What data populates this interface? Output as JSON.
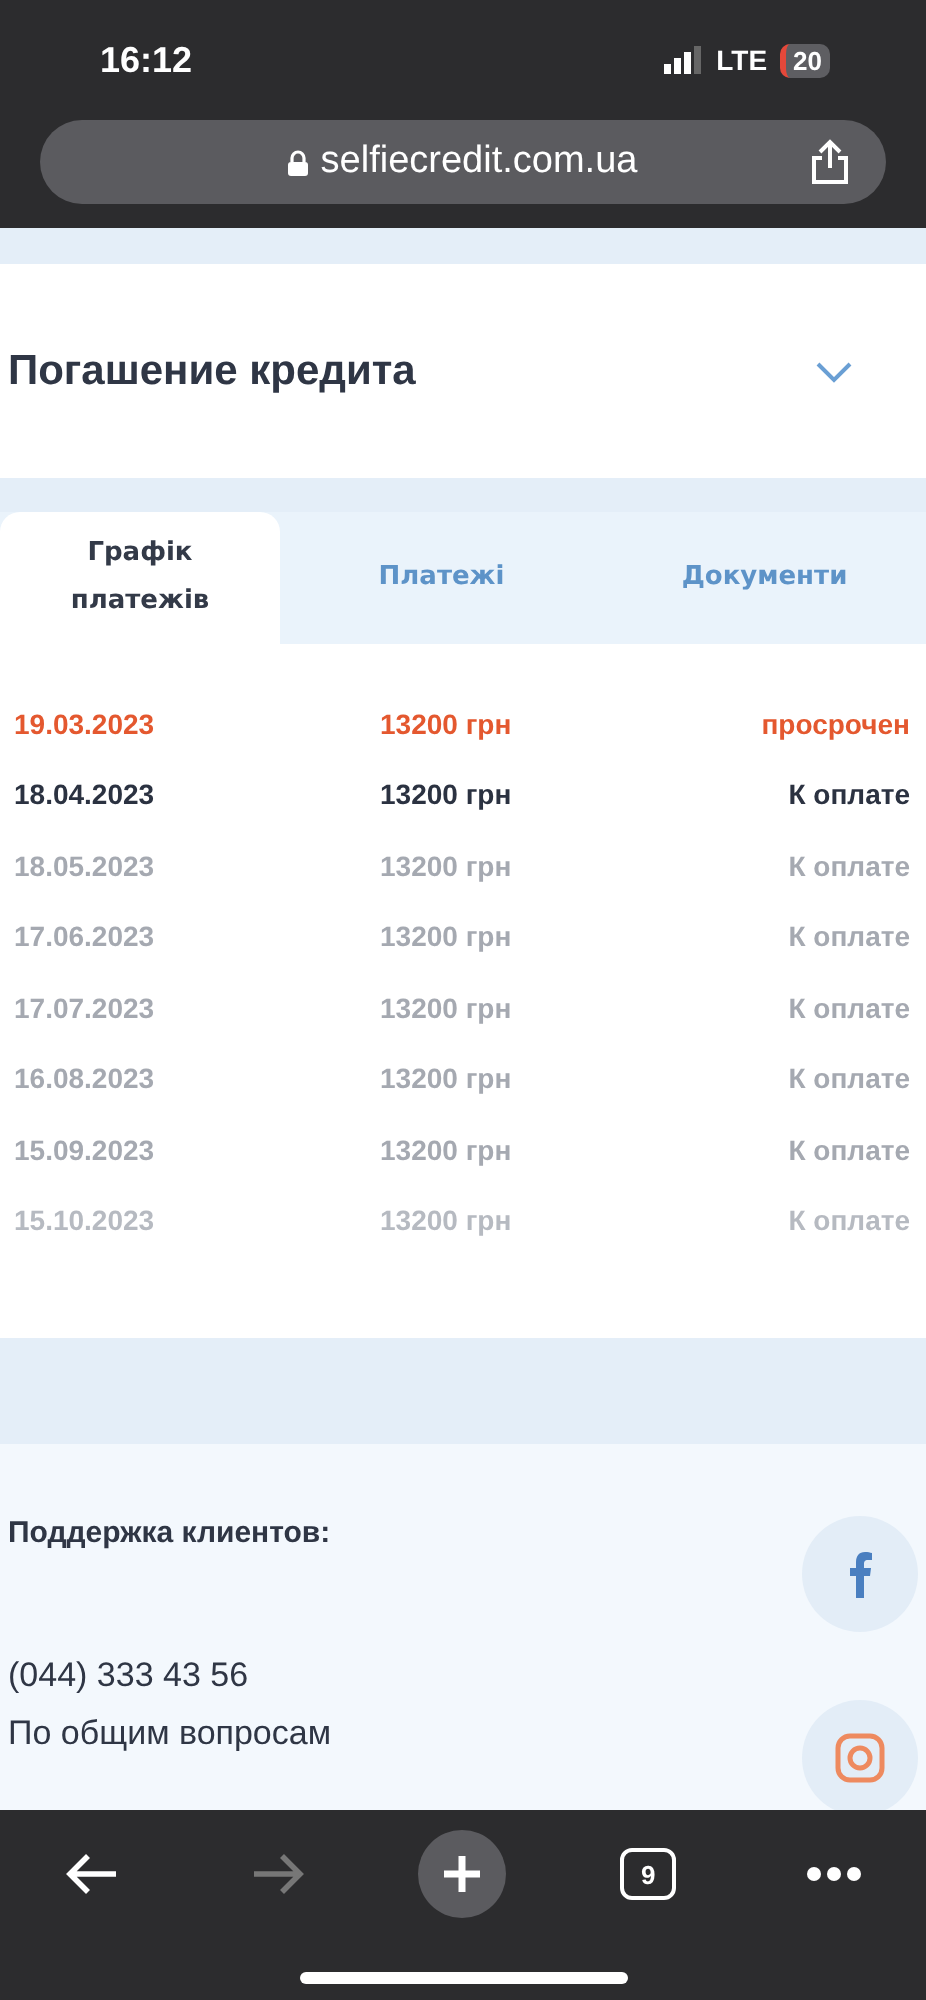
{
  "status_bar": {
    "time": "16:12",
    "network": "LTE",
    "battery": "20"
  },
  "address_bar": {
    "url": "selfiecredit.com.ua"
  },
  "section": {
    "title": "Погашение кредита",
    "expanded": true
  },
  "tabs": [
    {
      "label": "Графік платежів",
      "selected": true
    },
    {
      "label": "Платежі",
      "selected": false
    },
    {
      "label": "Документи",
      "selected": false
    }
  ],
  "payments": [
    {
      "date": "19.03.2023",
      "amount": "13200 грн",
      "status": "просрочен",
      "kind": "overdue"
    },
    {
      "date": "18.04.2023",
      "amount": "13200 грн",
      "status": "К оплате",
      "kind": "current"
    },
    {
      "date": "18.05.2023",
      "amount": "13200 грн",
      "status": "К оплате",
      "kind": "upcoming"
    },
    {
      "date": "17.06.2023",
      "amount": "13200 грн",
      "status": "К оплате",
      "kind": "upcoming"
    },
    {
      "date": "17.07.2023",
      "amount": "13200 грн",
      "status": "К оплате",
      "kind": "upcoming"
    },
    {
      "date": "16.08.2023",
      "amount": "13200 грн",
      "status": "К оплате",
      "kind": "upcoming"
    },
    {
      "date": "15.09.2023",
      "amount": "13200 грн",
      "status": "К оплате",
      "kind": "upcoming"
    },
    {
      "date": "15.10.2023",
      "amount": "13200 грн",
      "status": "К оплате",
      "kind": "faded"
    }
  ],
  "support": {
    "title": "Поддержка клиентов:",
    "phone": "(044) 333 43 56",
    "note": "По общим вопросам"
  },
  "browser_toolbar": {
    "tab_count": "9"
  }
}
